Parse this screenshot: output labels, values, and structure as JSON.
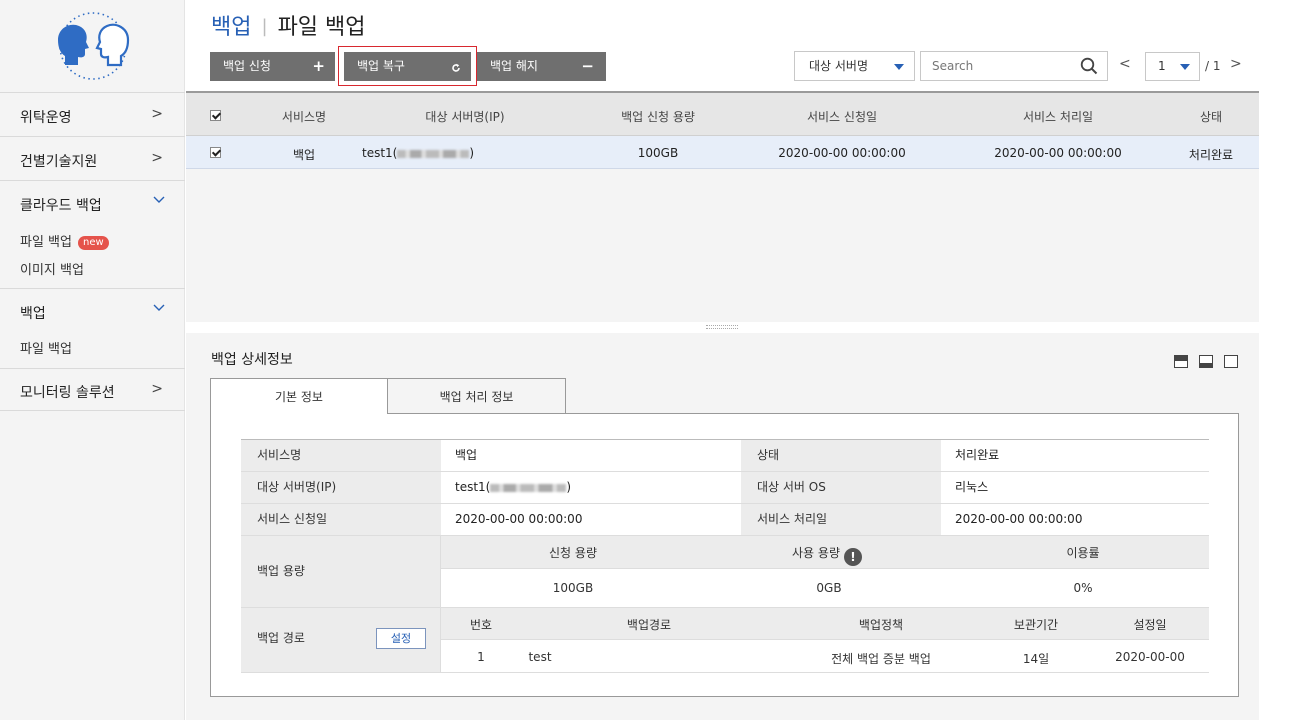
{
  "sidebar": {
    "groups": [
      {
        "label": "위탁운영"
      },
      {
        "label": "건별기술지원"
      },
      {
        "label": "클라우드 백업",
        "items": [
          {
            "label": "파일 백업",
            "badge": "new"
          },
          {
            "label": "이미지 백업"
          }
        ]
      },
      {
        "label": "백업",
        "items": [
          {
            "label": "파일 백업"
          }
        ]
      },
      {
        "label": "모니터링 솔루션"
      }
    ]
  },
  "header": {
    "title": "백업",
    "subtitle": "파일 백업"
  },
  "toolbar": {
    "apply_label": "백업 신청",
    "restore_label": "백업 복구",
    "cancel_label": "백업 해지",
    "server_select_value": "대상 서버명",
    "search_placeholder": "Search",
    "page_current": "1",
    "page_total": "/ 1"
  },
  "grid": {
    "columns": [
      "서비스명",
      "대상 서버명(IP)",
      "백업 신청 용량",
      "서비스 신청일",
      "서비스 처리일",
      "상태"
    ],
    "rows": [
      {
        "service": "백업",
        "server": "test1(",
        "server_close": ")",
        "capacity": "100GB",
        "apply_date": "2020-00-00 00:00:00",
        "process_date": "2020-00-00 00:00:00",
        "status": "처리완료"
      }
    ]
  },
  "detail": {
    "title": "백업 상세정보",
    "tabs": [
      "기본 정보",
      "백업 처리 정보"
    ],
    "info": {
      "service_label": "서비스명",
      "service_value": "백업",
      "status_label": "상태",
      "status_value": "처리완료",
      "server_label": "대상 서버명(IP)",
      "server_value": "test1(",
      "server_close": ")",
      "os_label": "대상 서버 OS",
      "os_value": "리눅스",
      "apply_label": "서비스 신청일",
      "apply_value": "2020-00-00 00:00:00",
      "process_label": "서비스 처리일",
      "process_value": "2020-00-00 00:00:00",
      "capacity_label": "백업 용량",
      "capacity_headers": [
        "신청 용량",
        "사용 용량",
        "이용률"
      ],
      "capacity_values": [
        "100GB",
        "0GB",
        "0%"
      ],
      "info_icon_glyph": "!",
      "path_label": "백업 경로",
      "path_button": "설정",
      "path_headers": [
        "번호",
        "백업경로",
        "백업정책",
        "보관기간",
        "설정일"
      ],
      "path_rows": [
        {
          "no": "1",
          "path": "test",
          "policy": "전체 백업 증분 백업",
          "retention": "14일",
          "date": "2020-00-00"
        }
      ]
    }
  },
  "colors": {
    "accent": "#2760b5",
    "button_gray": "#6f6f6f",
    "highlight_red": "#d8282f",
    "badge_red": "#e5534b"
  }
}
